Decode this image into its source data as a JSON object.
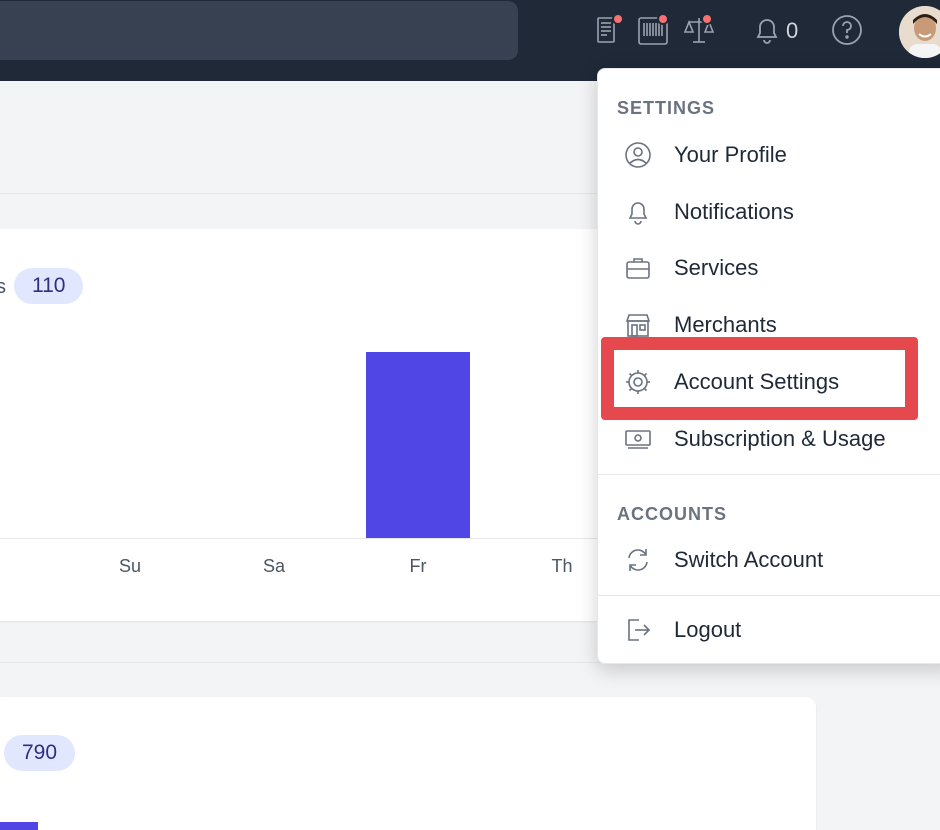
{
  "topbar": {
    "notification_count": "0",
    "icons": [
      "barcode-list-icon",
      "barcode-icon",
      "scale-icon",
      "bell-icon",
      "help-icon",
      "avatar"
    ]
  },
  "chart1": {
    "label_fragment": "s",
    "total": "110",
    "chart_data": {
      "type": "bar",
      "categories": [
        "Su",
        "Sa",
        "Fr",
        "Th"
      ],
      "values": [
        0,
        0,
        1,
        0
      ],
      "ylim": [
        0,
        1.25
      ]
    }
  },
  "chart2": {
    "total": "790"
  },
  "menu": {
    "settings_title": "SETTINGS",
    "settings_items": [
      {
        "label": "Your Profile",
        "icon": "user-circle-icon"
      },
      {
        "label": "Notifications",
        "icon": "bell-icon"
      },
      {
        "label": "Services",
        "icon": "briefcase-icon"
      },
      {
        "label": "Merchants",
        "icon": "store-icon"
      },
      {
        "label": "Account Settings",
        "icon": "cog-icon"
      },
      {
        "label": "Subscription & Usage",
        "icon": "cash-icon"
      }
    ],
    "accounts_title": "ACCOUNTS",
    "switch_label": "Switch Account",
    "logout_label": "Logout"
  },
  "colors": {
    "accent": "#4f46e5",
    "highlight": "#e5484d",
    "topbar": "#1f2937"
  }
}
